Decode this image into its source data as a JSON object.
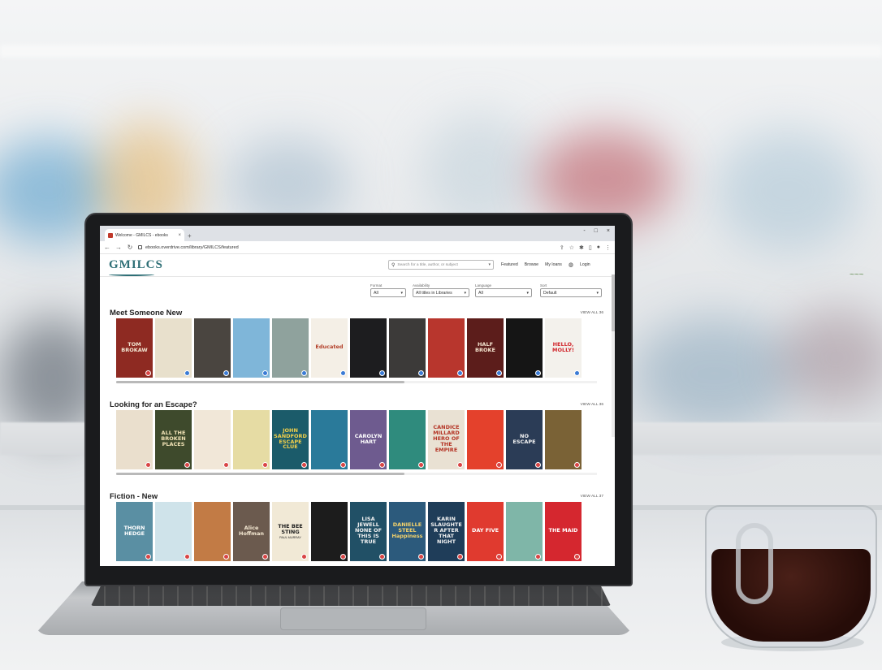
{
  "browser": {
    "tab_title": "Welcome - GMILCS - ebooks",
    "url": "ebooks.overdrive.com/library/GMILCS/featured",
    "window_controls": [
      "-",
      "□",
      "×"
    ]
  },
  "site": {
    "logo": "GMILCS",
    "search_placeholder": "Search for a title, author, or subject",
    "nav": [
      "Featured",
      "Browse",
      "My loans",
      "Login"
    ]
  },
  "filters": [
    {
      "label": "Format",
      "value": "All"
    },
    {
      "label": "Availability",
      "value": "All titles in Libraries"
    },
    {
      "label": "Language",
      "value": "All"
    },
    {
      "label": "Sort",
      "value": "Default"
    }
  ],
  "shelves": [
    {
      "title": "Meet Someone New",
      "view_all": "VIEW ALL 36",
      "covers": [
        {
          "title": "TOM BROKAW",
          "author": "",
          "bg": "#8e2a22",
          "fg": "#f2e6d2",
          "badge": "#d94545"
        },
        {
          "title": "",
          "author": "",
          "bg": "#e8e0cc",
          "fg": "#2b2b2b",
          "badge": "#3a7bd5"
        },
        {
          "title": "",
          "author": "",
          "bg": "#4a4540",
          "fg": "#f0ece4",
          "badge": "#3a7bd5"
        },
        {
          "title": "",
          "author": "",
          "bg": "#7fb6d9",
          "fg": "#1f3a4f",
          "badge": "#3a7bd5"
        },
        {
          "title": "",
          "author": "",
          "bg": "#8fa29d",
          "fg": "#ffffff",
          "badge": "#3a7bd5"
        },
        {
          "title": "Educated",
          "author": "",
          "bg": "#f4efe6",
          "fg": "#b3402a",
          "badge": "#3a7bd5"
        },
        {
          "title": "",
          "author": "",
          "bg": "#1d1d1f",
          "fg": "#e8e8e8",
          "badge": "#3a7bd5"
        },
        {
          "title": "",
          "author": "",
          "bg": "#3c3a39",
          "fg": "#f2f2f2",
          "badge": "#3a7bd5"
        },
        {
          "title": "",
          "author": "",
          "bg": "#b8362d",
          "fg": "#f5d37a",
          "badge": "#3a7bd5"
        },
        {
          "title": "HALF BROKE",
          "author": "",
          "bg": "#5c1d1b",
          "fg": "#f4e4cf",
          "badge": "#3a7bd5"
        },
        {
          "title": "",
          "author": "",
          "bg": "#151515",
          "fg": "#f0f0f0",
          "badge": "#3a7bd5"
        },
        {
          "title": "HELLO, MOLLY!",
          "author": "",
          "bg": "#f3f1ec",
          "fg": "#d1262c",
          "badge": "#3a7bd5"
        }
      ]
    },
    {
      "title": "Looking for an Escape?",
      "view_all": "VIEW ALL 36",
      "covers": [
        {
          "title": "",
          "author": "",
          "bg": "#eadfcd",
          "fg": "#6d5a43",
          "badge": "#d94545"
        },
        {
          "title": "ALL THE BROKEN PLACES",
          "author": "",
          "bg": "#3e4a2c",
          "fg": "#f1e3b6",
          "badge": "#d94545"
        },
        {
          "title": "",
          "author": "",
          "bg": "#f1e7d8",
          "fg": "#b4372c",
          "badge": "#d94545"
        },
        {
          "title": "",
          "author": "",
          "bg": "#e6dca4",
          "fg": "#7c6d30",
          "badge": "#d94545"
        },
        {
          "title": "JOHN SANDFORD ESCAPE CLUE",
          "author": "",
          "bg": "#1b5b6a",
          "fg": "#f3d04a",
          "badge": "#d94545"
        },
        {
          "title": "",
          "author": "",
          "bg": "#2a7a9a",
          "fg": "#f7d24b",
          "badge": "#d94545"
        },
        {
          "title": "CAROLYN HART",
          "author": "",
          "bg": "#6e5b8f",
          "fg": "#ffffff",
          "badge": "#d94545"
        },
        {
          "title": "",
          "author": "",
          "bg": "#2f8b7d",
          "fg": "#f4e2b2",
          "badge": "#d94545"
        },
        {
          "title": "CANDICE MILLARD HERO OF THE EMPIRE",
          "author": "",
          "bg": "#e9e1d3",
          "fg": "#b43425",
          "badge": "#d94545"
        },
        {
          "title": "",
          "author": "",
          "bg": "#e4412c",
          "fg": "#ffffff",
          "badge": "#d94545"
        },
        {
          "title": "NO ESCAPE",
          "author": "",
          "bg": "#2b3c56",
          "fg": "#f3f3f3",
          "badge": "#d94545"
        },
        {
          "title": "",
          "author": "",
          "bg": "#7a6236",
          "fg": "#e8c46b",
          "badge": "#d94545"
        }
      ]
    },
    {
      "title": "Fiction - New",
      "view_all": "VIEW ALL 37",
      "covers": [
        {
          "title": "THORN HEDGE",
          "author": "",
          "bg": "#5a8fa3",
          "fg": "#ffffff",
          "badge": "#d94545"
        },
        {
          "title": "",
          "author": "",
          "bg": "#cfe3ea",
          "fg": "#6a3f55",
          "badge": "#d94545"
        },
        {
          "title": "",
          "author": "",
          "bg": "#c27b45",
          "fg": "#3b2415",
          "badge": "#d94545"
        },
        {
          "title": "Alice Hoffman",
          "author": "",
          "bg": "#6b5a4e",
          "fg": "#f4e8d2",
          "badge": "#d94545"
        },
        {
          "title": "THE BEE STING",
          "author": "PAUL MURRAY",
          "bg": "#f1e9d6",
          "fg": "#1f1f1f",
          "badge": "#d94545"
        },
        {
          "title": "",
          "author": "",
          "bg": "#1c1c1c",
          "fg": "#9a9a9a",
          "badge": "#d94545"
        },
        {
          "title": "LISA JEWELL NONE OF THIS IS TRUE",
          "author": "",
          "bg": "#215066",
          "fg": "#f3f3f3",
          "badge": "#d94545"
        },
        {
          "title": "DANIELLE STEEL Happiness",
          "author": "",
          "bg": "#2c5a7c",
          "fg": "#f5d36b",
          "badge": "#d94545"
        },
        {
          "title": "KARIN SLAUGHTER AFTER THAT NIGHT",
          "author": "",
          "bg": "#1f3d59",
          "fg": "#f2f2f2",
          "badge": "#d94545"
        },
        {
          "title": "DAY FIVE",
          "author": "",
          "bg": "#e03a2f",
          "fg": "#ffffff",
          "badge": "#d94545"
        },
        {
          "title": "",
          "author": "",
          "bg": "#7fb6a8",
          "fg": "#ffffff",
          "badge": "#d94545"
        },
        {
          "title": "THE MAID",
          "author": "",
          "bg": "#d5272f",
          "fg": "#ffffff",
          "badge": "#d94545"
        }
      ]
    }
  ],
  "scroll": [
    0.6,
    0.6,
    0.6
  ]
}
